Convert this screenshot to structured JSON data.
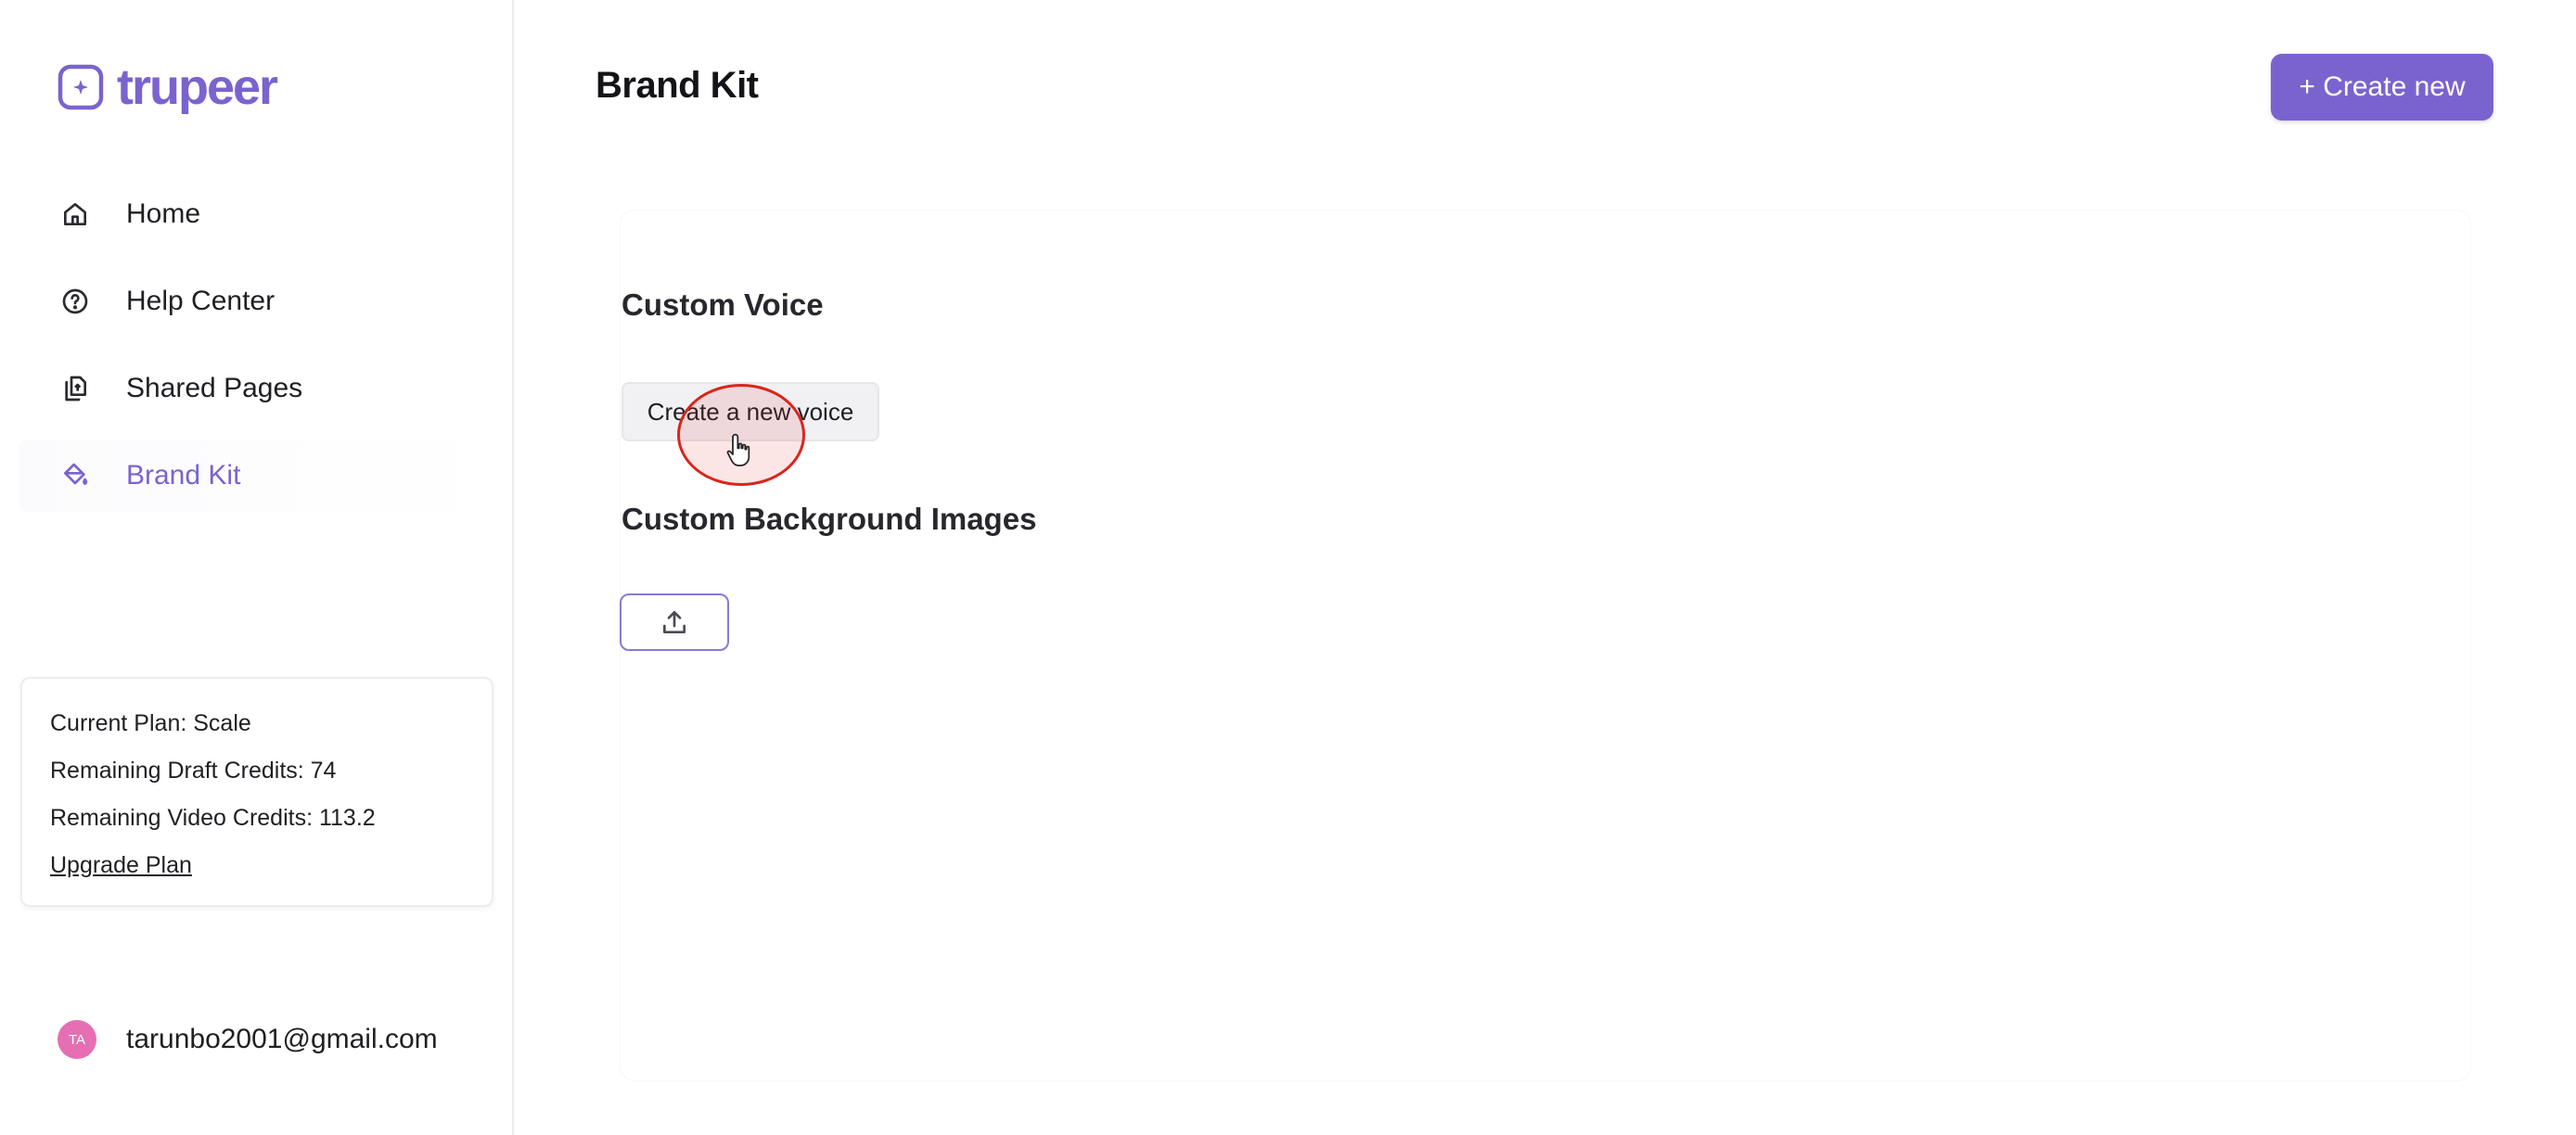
{
  "app": {
    "logo_text": "trupeer",
    "brand_color": "#7a63cf"
  },
  "sidebar": {
    "items": [
      {
        "label": "Home",
        "icon": "home-icon",
        "active": false
      },
      {
        "label": "Help Center",
        "icon": "help-circle-icon",
        "active": false
      },
      {
        "label": "Shared Pages",
        "icon": "shared-pages-icon",
        "active": false
      },
      {
        "label": "Brand Kit",
        "icon": "paint-bucket-icon",
        "active": true
      }
    ],
    "plan": {
      "current_plan": "Current Plan: Scale",
      "draft_credits": "Remaining Draft Credits: 74",
      "video_credits": "Remaining Video Credits: 113.2",
      "upgrade_label": "Upgrade Plan"
    },
    "user": {
      "initials": "TA",
      "email": "tarunbo2001@gmail.com",
      "avatar_color": "#e66fb3"
    }
  },
  "header": {
    "title": "Brand Kit",
    "create_label": "+ Create new"
  },
  "main": {
    "custom_voice": {
      "title": "Custom Voice",
      "button_label": "Create a new voice"
    },
    "custom_backgrounds": {
      "title": "Custom Background Images",
      "upload_icon": "upload-icon"
    }
  }
}
